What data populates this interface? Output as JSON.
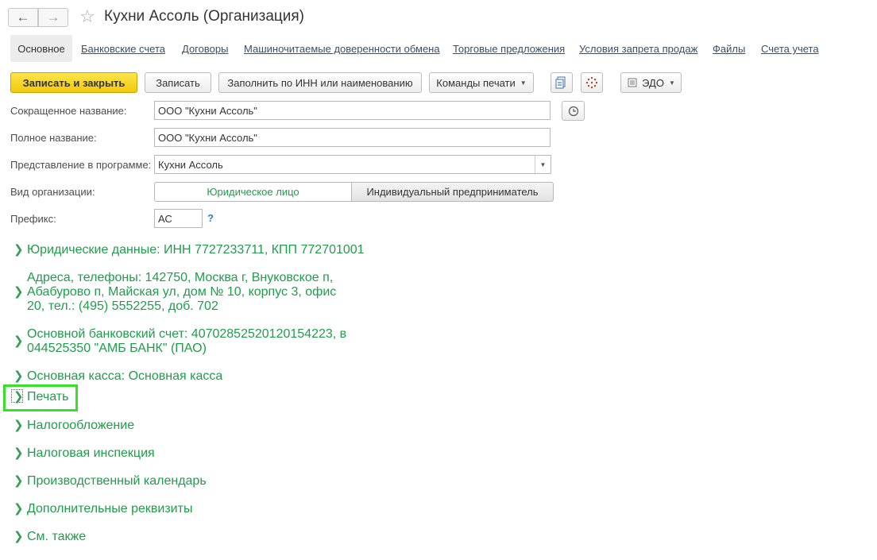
{
  "window": {
    "title": "Кухни Ассоль (Организация)"
  },
  "icons": {
    "back": "arrow-left-icon",
    "forward": "arrow-right-icon",
    "favorite": "star-icon",
    "history": "history-icon",
    "help": "question-icon"
  },
  "tabs": [
    {
      "label": "Основное",
      "active": true
    },
    {
      "label": "Банковские счета"
    },
    {
      "label": "Договоры"
    },
    {
      "label": "Машиночитаемые доверенности обмена"
    },
    {
      "label": "Торговые предложения"
    },
    {
      "label": "Условия запрета продаж"
    },
    {
      "label": "Файлы"
    },
    {
      "label": "Счета учета"
    }
  ],
  "toolbar": {
    "save_close": "Записать и закрыть",
    "save": "Записать",
    "fill_inn": "Заполнить по ИНН или наименованию",
    "print_commands": "Команды печати",
    "edo": "ЭДО"
  },
  "form": {
    "short_name_label": "Сокращенное название:",
    "short_name_value": "ООО \"Кухни Ассоль\"",
    "full_name_label": "Полное название:",
    "full_name_value": "ООО \"Кухни Ассоль\"",
    "presentation_label": "Представление в программе:",
    "presentation_value": "Кухни Ассоль",
    "org_type_label": "Вид организации:",
    "org_type_options": [
      "Юридическое лицо",
      "Индивидуальный предприниматель"
    ],
    "org_type_selected": "Юридическое лицо",
    "prefix_label": "Префикс:",
    "prefix_value": "АС",
    "help_mark": "?"
  },
  "groups": {
    "legal": "Юридические данные: ИНН 7727233711, КПП 772701001",
    "address_line1": "Адреса, телефоны: 142750, Москва г, Внуковское п,",
    "address_line2": "Абабурово п, Майская ул, дом № 10, корпус 3, офис",
    "address_line3": "20, тел.: (495) 5552255, доб. 702",
    "bank_line1": "Основной банковский счет: 40702852520120154223, в",
    "bank_line2": "044525350 \"АМБ БАНК\" (ПАО)",
    "cash": "Основная касса: Основная касса",
    "print": "Печать",
    "taxation": "Налогообложение",
    "tax_office": "Налоговая инспекция",
    "calendar": "Производственный календарь",
    "extra": "Дополнительные реквизиты",
    "see_also": "См. также"
  },
  "colors": {
    "accent_green": "#1f9d4a",
    "highlight": "#38e02a",
    "primary_button": "#f3c90c",
    "link": "#37506a"
  }
}
